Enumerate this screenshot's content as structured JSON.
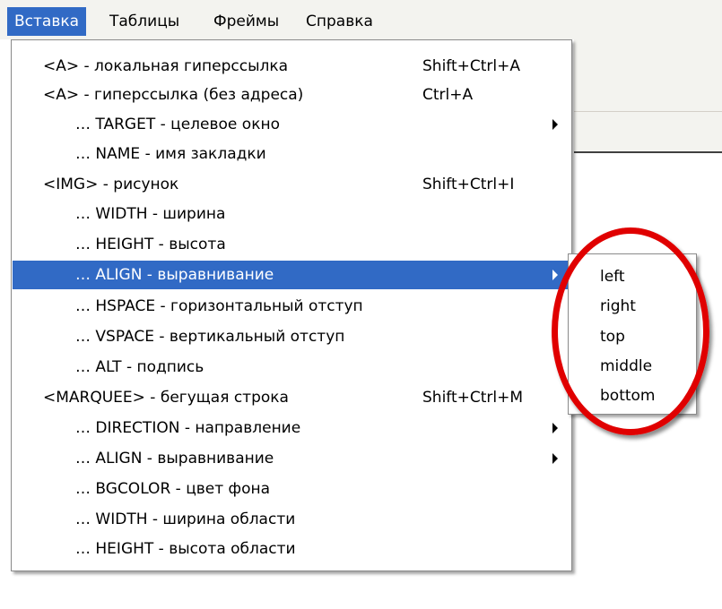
{
  "menubar": {
    "items": [
      {
        "label": "Вставка",
        "active": true
      },
      {
        "label": "Таблицы"
      },
      {
        "label": "Фреймы"
      },
      {
        "label": "Справка"
      }
    ]
  },
  "dropdown": {
    "items": [
      {
        "label": "<A> - локальная гиперссылка",
        "shortcut": "Shift+Ctrl+A"
      },
      {
        "label": "<A> - гиперссылка (без адреса)",
        "shortcut": "Ctrl+A"
      },
      {
        "label": "… TARGET - целевое окно",
        "submenu": true
      },
      {
        "label": "… NAME - имя закладки"
      },
      {
        "label": "<IMG> - рисунок",
        "shortcut": "Shift+Ctrl+I"
      },
      {
        "label": "… WIDTH - ширина"
      },
      {
        "label": "… HEIGHT - высота"
      },
      {
        "label": "… ALIGN - выравнивание",
        "submenu": true,
        "highlighted": true
      },
      {
        "label": "… HSPACE - горизонтальный отступ"
      },
      {
        "label": "… VSPACE - вертикальный отступ"
      },
      {
        "label": "… ALT - подпись"
      },
      {
        "label": "<MARQUEE> - бегущая строка",
        "shortcut": "Shift+Ctrl+M"
      },
      {
        "label": "… DIRECTION - направление",
        "submenu": true
      },
      {
        "label": "… ALIGN - выравнивание",
        "submenu": true
      },
      {
        "label": "… BGCOLOR - цвет фона"
      },
      {
        "label": "… WIDTH - ширина области"
      },
      {
        "label": "… HEIGHT - высота области"
      }
    ]
  },
  "submenu": {
    "items": [
      "left",
      "right",
      "top",
      "middle",
      "bottom"
    ]
  },
  "colors": {
    "highlight": "#316ac5",
    "annotation": "#e00000",
    "menubar_bg": "#f3f3ef"
  }
}
